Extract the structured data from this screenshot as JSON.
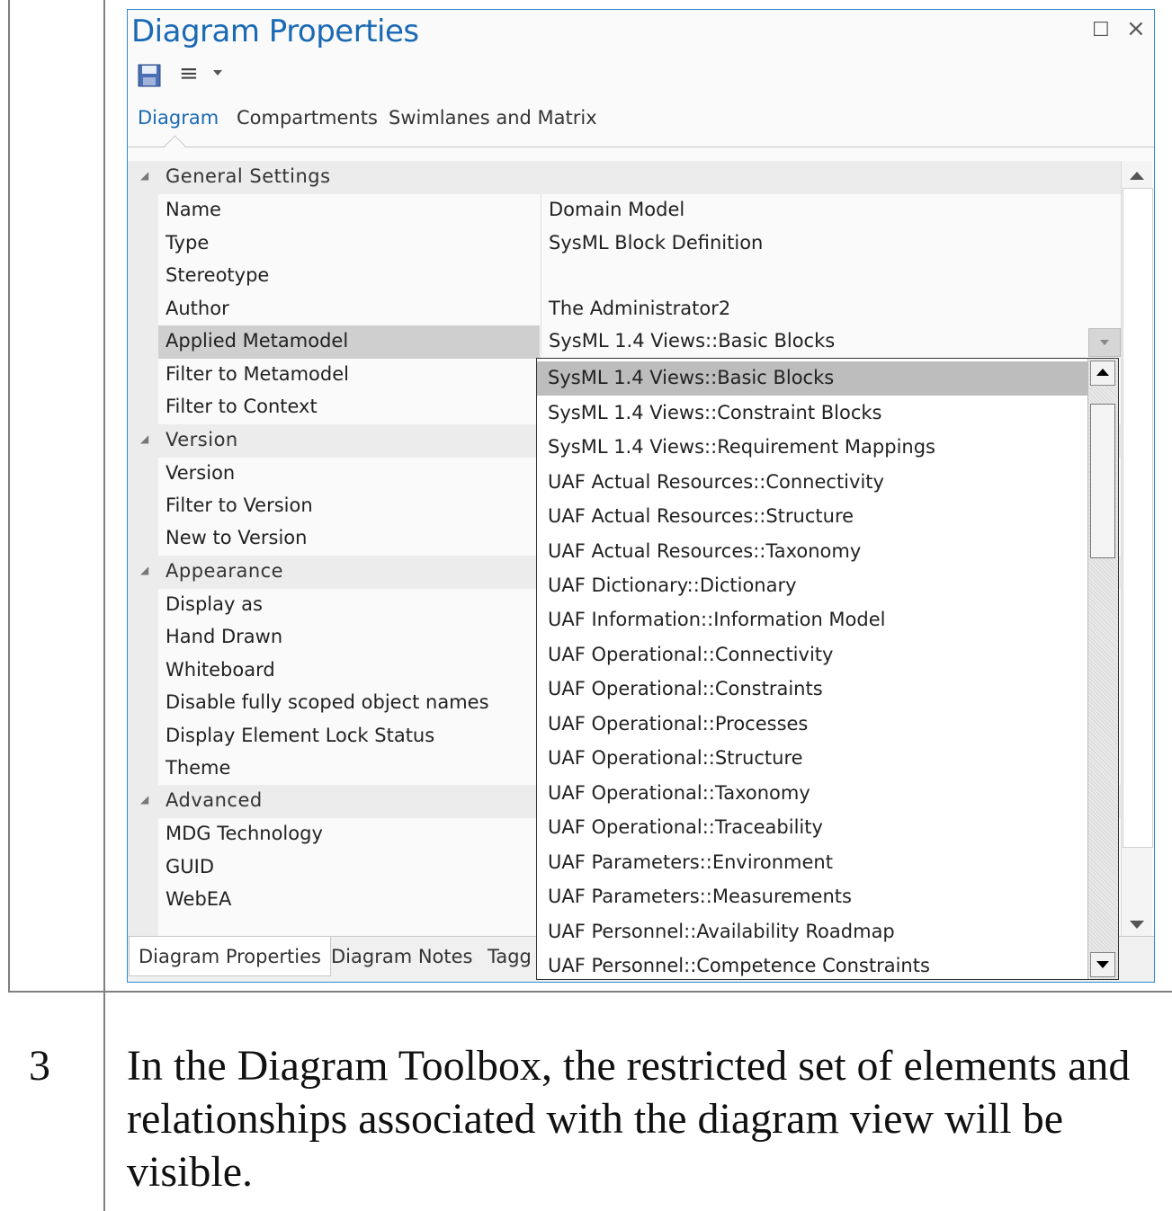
{
  "window": {
    "title": "Diagram Properties",
    "restore_glyph": "☐",
    "close_glyph": "×",
    "menu_glyph": "≡"
  },
  "tabs": [
    {
      "label": "Diagram",
      "active": true
    },
    {
      "label": "Compartments",
      "active": false
    },
    {
      "label": "Swimlanes and Matrix",
      "active": false
    }
  ],
  "categories": {
    "general": "General Settings",
    "version": "Version",
    "appearance": "Appearance",
    "advanced": "Advanced"
  },
  "properties": {
    "name": {
      "label": "Name",
      "value": "Domain Model"
    },
    "type": {
      "label": "Type",
      "value": "SysML Block Definition"
    },
    "stereotype": {
      "label": "Stereotype",
      "value": ""
    },
    "author": {
      "label": "Author",
      "value": "The Administrator2"
    },
    "applied_metamodel": {
      "label": "Applied Metamodel",
      "value": "SysML 1.4 Views::Basic Blocks"
    },
    "filter_metamodel": {
      "label": "Filter to Metamodel"
    },
    "filter_context": {
      "label": "Filter to Context"
    },
    "version": {
      "label": "Version"
    },
    "filter_version": {
      "label": "Filter to Version"
    },
    "new_version": {
      "label": "New to Version"
    },
    "display_as": {
      "label": "Display as"
    },
    "hand_drawn": {
      "label": "Hand Drawn"
    },
    "whiteboard": {
      "label": "Whiteboard"
    },
    "disable_scoped": {
      "label": "Disable fully scoped object names"
    },
    "lock_status": {
      "label": "Display Element Lock Status"
    },
    "theme": {
      "label": "Theme"
    },
    "mdg": {
      "label": "MDG Technology"
    },
    "guid": {
      "label": "GUID"
    },
    "webea": {
      "label": "WebEA"
    }
  },
  "dropdown": {
    "items": [
      "SysML 1.4 Views::Basic Blocks",
      "SysML 1.4 Views::Constraint Blocks",
      "SysML 1.4 Views::Requirement Mappings",
      "UAF Actual Resources::Connectivity",
      "UAF Actual Resources::Structure",
      "UAF Actual Resources::Taxonomy",
      "UAF Dictionary::Dictionary",
      "UAF Information::Information Model",
      "UAF Operational::Connectivity",
      "UAF Operational::Constraints",
      "UAF Operational::Processes",
      "UAF Operational::Structure",
      "UAF Operational::Taxonomy",
      "UAF Operational::Traceability",
      "UAF Parameters::Environment",
      "UAF Parameters::Measurements",
      "UAF Personnel::Availability Roadmap",
      "UAF Personnel::Competence Constraints"
    ],
    "selected": "SysML 1.4 Views::Basic Blocks"
  },
  "bottom_tabs": [
    {
      "label": "Diagram Properties",
      "active": true
    },
    {
      "label": "Diagram Notes",
      "active": false
    },
    {
      "label": "Tagg",
      "active": false
    }
  ],
  "step": {
    "number": "3",
    "text": "In the Diagram Toolbox, the restricted set of elements and relationships associated with the diagram view will be visible."
  }
}
